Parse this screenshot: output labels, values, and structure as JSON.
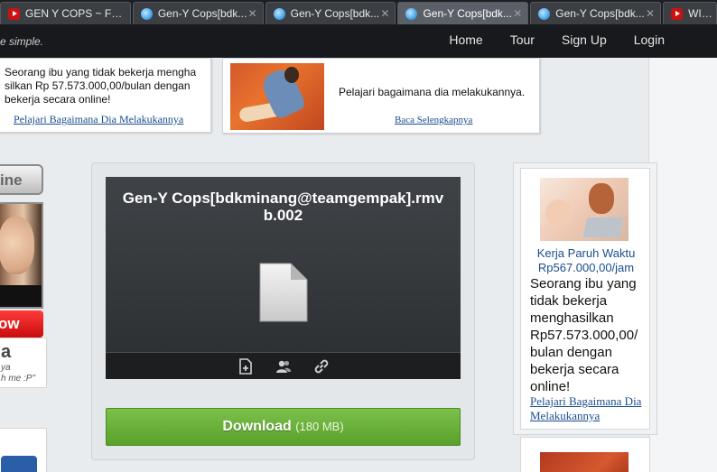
{
  "tabs": [
    {
      "label": "GEN Y COPS ~ Fr...",
      "favicon": "youtube-icon",
      "active": false
    },
    {
      "label": "Gen-Y Cops[bdk...",
      "favicon": "gen-y-globe-icon",
      "active": false
    },
    {
      "label": "Gen-Y Cops[bdk...",
      "favicon": "gen-y-globe-icon",
      "active": false
    },
    {
      "label": "Gen-Y Cops[bdk...",
      "favicon": "gen-y-globe-icon",
      "active": true
    },
    {
      "label": "Gen-Y Cops[bdk...",
      "favicon": "gen-y-globe-icon",
      "active": false
    },
    {
      "label": "WILL I",
      "favicon": "youtube-icon",
      "active": false
    }
  ],
  "tab_close": "✕",
  "header": {
    "tagline": "e simple.",
    "nav": [
      "Home",
      "Tour",
      "Sign Up",
      "Login"
    ]
  },
  "ad_top_left": {
    "text": "Seorang ibu yang tidak bekerja mengha silkan Rp 57.573.000,00/bulan dengan bekerja secara online!",
    "link": "Pelajari Bagaimana Dia Melakukannya"
  },
  "ad_top_right": {
    "text": "Pelajari bagaimana dia melakukannya.",
    "link": "Baca Selengkapnya"
  },
  "left_column": {
    "button_fragment": "ine",
    "red_fragment": "ow",
    "card_big": "a",
    "card_line1": "ya",
    "card_line2": "h me :P\""
  },
  "file": {
    "name": "Gen-Y Cops[bdkminang@teamgempak].rmvb.002",
    "download_label": "Download",
    "download_size": "(180 MB)"
  },
  "ad_right": {
    "title": "Kerja Paruh Waktu Rp567.000,00/jam",
    "body": "Seorang ibu yang tidak bekerja menghasilkan Rp57.573.000,00/ bulan dengan bekerja secara online!",
    "link": "Pelajari Bagaimana Dia Melakukannya"
  },
  "colors": {
    "download_green": "#6db33f",
    "header_black": "#17191c",
    "link_blue": "#1a4d8f"
  }
}
